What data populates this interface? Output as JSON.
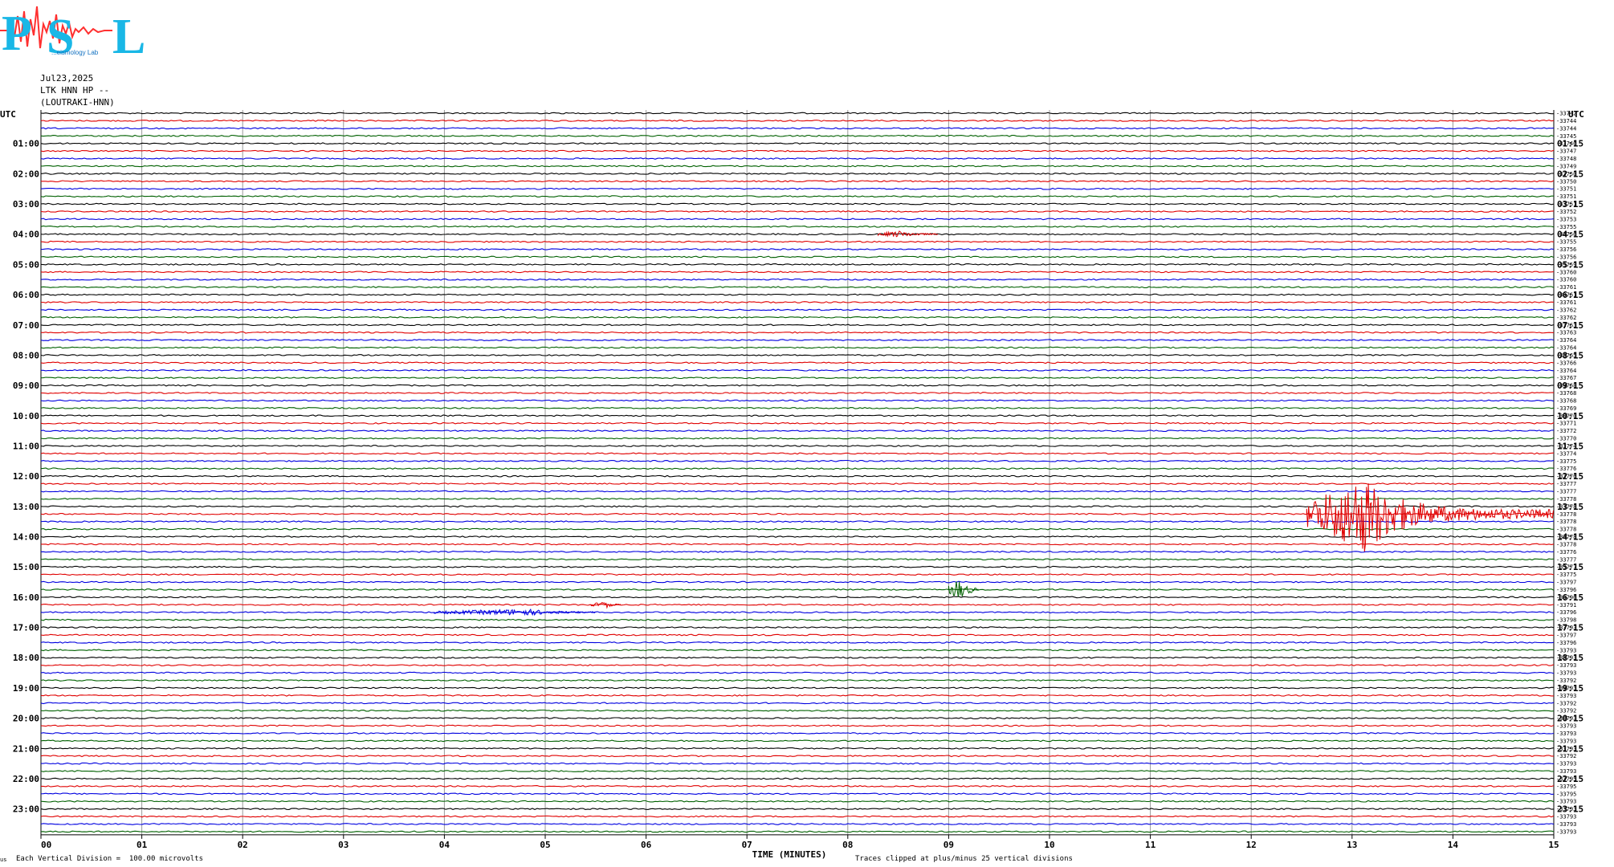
{
  "logo": {
    "letters": [
      "P",
      "S",
      "L"
    ],
    "subtitle": "...eismology Lab",
    "icon": "seismic-wave-icon"
  },
  "header": {
    "date": "Jul23,2025",
    "station": "LTK HNN HP --",
    "site": "(LOUTRAKI-HNN)"
  },
  "footer": {
    "legend": "Each Vertical Division =  100.00 microvolts",
    "clip_note": "Traces clipped at plus/minus 25 vertical divisions",
    "corner_mark": "us"
  },
  "chart_data": {
    "type": "line",
    "title": "",
    "xlabel": "TIME (MINUTES)",
    "x_ticks": [
      "00",
      "01",
      "02",
      "03",
      "04",
      "05",
      "06",
      "07",
      "08",
      "09",
      "10",
      "11",
      "12",
      "13",
      "14",
      "15"
    ],
    "xlim": [
      0,
      15
    ],
    "left_axis_label": "UTC",
    "right_axis_label": "UTC",
    "left_time_labels": [
      "01:00",
      "02:00",
      "03:00",
      "04:00",
      "05:00",
      "06:00",
      "07:00",
      "08:00",
      "09:00",
      "10:00",
      "11:00",
      "12:00",
      "13:00",
      "14:00",
      "15:00",
      "16:00",
      "17:00",
      "18:00",
      "19:00",
      "20:00",
      "21:00",
      "22:00",
      "23:00"
    ],
    "right_time_labels": [
      "01:15",
      "02:15",
      "03:15",
      "04:15",
      "05:15",
      "06:15",
      "07:15",
      "08:15",
      "09:15",
      "10:15",
      "11:15",
      "12:15",
      "13:15",
      "14:15",
      "15:15",
      "16:15",
      "17:15",
      "18:15",
      "19:15",
      "20:15",
      "21:15",
      "22:15",
      "23:15"
    ],
    "trace_colors": [
      "#000000",
      "#e00000",
      "#0000e0",
      "#006000"
    ],
    "trace_count": 96,
    "minutes_per_trace": 15,
    "right_trace_values": [
      "-33742",
      "-33744",
      "-33744",
      "-33745",
      "-33746",
      "-33747",
      "-33748",
      "-33749",
      "-33750",
      "-33750",
      "-33751",
      "-33751",
      "-33751",
      "-33752",
      "-33753",
      "-33755",
      "-33756",
      "-33755",
      "-33756",
      "-33756",
      "-33759",
      "-33760",
      "-33760",
      "-33761",
      "-33761",
      "-33761",
      "-33762",
      "-33762",
      "-33763",
      "-33763",
      "-33764",
      "-33764",
      "-33765",
      "-33766",
      "-33764",
      "-33767",
      "-33768",
      "-33768",
      "-33768",
      "-33769",
      "-33770",
      "-33771",
      "-33772",
      "-33770",
      "-33774",
      "-33774",
      "-33775",
      "-33776",
      "-33776",
      "-33777",
      "-33777",
      "-33778",
      "-33778",
      "-33778",
      "-33778",
      "-33778",
      "-33778",
      "-33778",
      "-33776",
      "-33777",
      "-33777",
      "-33775",
      "-33797",
      "-33796",
      "-33796",
      "-33791",
      "-33796",
      "-33798",
      "-33793",
      "-33797",
      "-33796",
      "-33793",
      "-33793",
      "-33793",
      "-33793",
      "-33792",
      "-33793",
      "-33793",
      "-33792",
      "-33792",
      "-33793",
      "-33793",
      "-33793",
      "-33793",
      "-33793",
      "-33792",
      "-33793",
      "-33793",
      "-33795",
      "-33795",
      "-33795",
      "-33793",
      "-33793",
      "-33793",
      "-33793",
      "-33793"
    ],
    "events": [
      {
        "name": "earthquake",
        "trace": 53,
        "start_min": 12.55,
        "peak_min": 13.1,
        "end_min": 15.0,
        "color": "#e00000"
      },
      {
        "name": "local-event",
        "trace": 63,
        "start_min": 9.0,
        "peak_min": 9.08,
        "end_min": 9.3,
        "color": "#006000"
      },
      {
        "name": "noise-burst",
        "trace": 66,
        "start_min": 3.9,
        "peak_min": 4.8,
        "end_min": 5.5,
        "color": "#0000e0"
      },
      {
        "name": "noise-burst",
        "trace": 65,
        "start_min": 5.45,
        "peak_min": 5.6,
        "end_min": 5.75,
        "color": "#e00000"
      },
      {
        "name": "noise-burst",
        "trace": 16,
        "start_min": 8.3,
        "peak_min": 8.5,
        "end_min": 8.9,
        "color": "#e00000"
      }
    ]
  }
}
